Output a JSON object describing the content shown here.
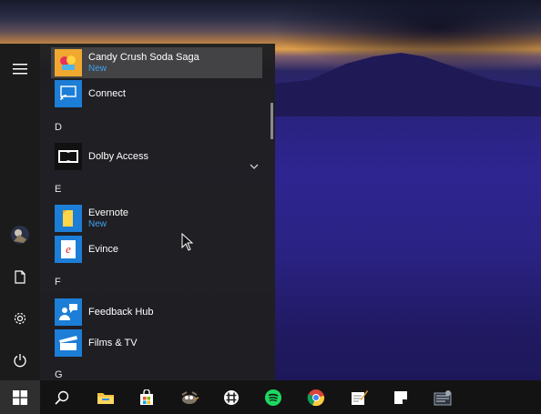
{
  "start_menu": {
    "apps": [
      {
        "name": "Candy Crush Soda Saga",
        "sub": "New",
        "icon": "candy-crush-icon"
      },
      {
        "name": "Connect",
        "icon": "connect-icon"
      },
      {
        "name": "Dolby Access",
        "icon": "dolby-icon"
      },
      {
        "name": "Evernote",
        "sub": "New",
        "icon": "evernote-icon"
      },
      {
        "name": "Evince",
        "icon": "evince-icon"
      },
      {
        "name": "Feedback Hub",
        "icon": "feedback-hub-icon"
      },
      {
        "name": "Films & TV",
        "icon": "films-tv-icon"
      }
    ],
    "letters": [
      "D",
      "E",
      "F",
      "G"
    ],
    "rail": [
      "hamburger-menu-icon",
      "user-avatar-icon",
      "documents-icon",
      "settings-icon",
      "power-icon"
    ]
  },
  "taskbar": {
    "icons": [
      "windows-start-icon",
      "search-icon",
      "file-explorer-icon",
      "microsoft-store-icon",
      "gimp-icon",
      "slack-icon",
      "spotify-icon",
      "chrome-icon",
      "notepad-icon",
      "sticky-notes-icon",
      "media-app-icon"
    ]
  },
  "colors": {
    "accent_new": "#3fa3ec",
    "tile_blue": "#1c7ed6",
    "menu_bg": "#1f1f21",
    "taskbar_bg": "#131313"
  }
}
